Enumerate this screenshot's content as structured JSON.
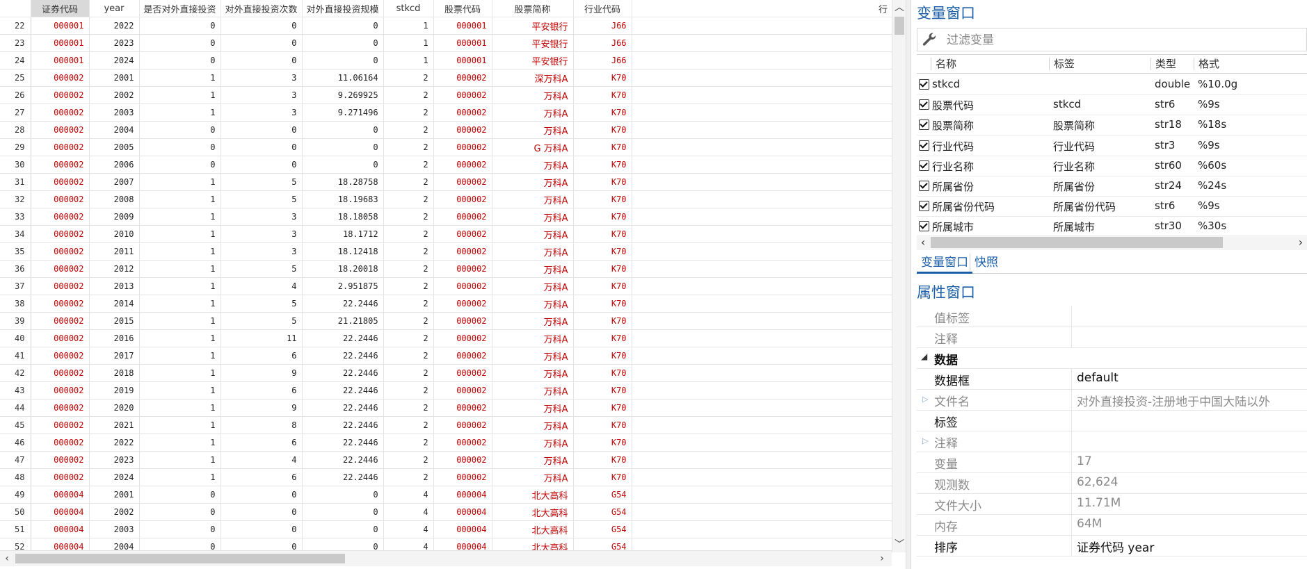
{
  "grid": {
    "columns": [
      "证券代码",
      "year",
      "是否对外直接投资",
      "对外直接投资次数",
      "对外直接投资规模",
      "stkcd",
      "股票代码",
      "股票简称",
      "行业代码"
    ],
    "extra_header": "行",
    "rows": [
      {
        "n": "22",
        "code": "000001",
        "year": "2022",
        "odi": "0",
        "times": "0",
        "scale": "0",
        "stkcd": "1",
        "stock": "000001",
        "name": "平安银行",
        "ind": "J66"
      },
      {
        "n": "23",
        "code": "000001",
        "year": "2023",
        "odi": "0",
        "times": "0",
        "scale": "0",
        "stkcd": "1",
        "stock": "000001",
        "name": "平安银行",
        "ind": "J66"
      },
      {
        "n": "24",
        "code": "000001",
        "year": "2024",
        "odi": "0",
        "times": "0",
        "scale": "0",
        "stkcd": "1",
        "stock": "000001",
        "name": "平安银行",
        "ind": "J66"
      },
      {
        "n": "25",
        "code": "000002",
        "year": "2001",
        "odi": "1",
        "times": "3",
        "scale": "11.06164",
        "stkcd": "2",
        "stock": "000002",
        "name": "深万科A",
        "ind": "K70"
      },
      {
        "n": "26",
        "code": "000002",
        "year": "2002",
        "odi": "1",
        "times": "3",
        "scale": "9.269925",
        "stkcd": "2",
        "stock": "000002",
        "name": "万科A",
        "ind": "K70"
      },
      {
        "n": "27",
        "code": "000002",
        "year": "2003",
        "odi": "1",
        "times": "3",
        "scale": "9.271496",
        "stkcd": "2",
        "stock": "000002",
        "name": "万科A",
        "ind": "K70"
      },
      {
        "n": "28",
        "code": "000002",
        "year": "2004",
        "odi": "0",
        "times": "0",
        "scale": "0",
        "stkcd": "2",
        "stock": "000002",
        "name": "万科A",
        "ind": "K70"
      },
      {
        "n": "29",
        "code": "000002",
        "year": "2005",
        "odi": "0",
        "times": "0",
        "scale": "0",
        "stkcd": "2",
        "stock": "000002",
        "name": "G 万科A",
        "ind": "K70"
      },
      {
        "n": "30",
        "code": "000002",
        "year": "2006",
        "odi": "0",
        "times": "0",
        "scale": "0",
        "stkcd": "2",
        "stock": "000002",
        "name": "万科A",
        "ind": "K70"
      },
      {
        "n": "31",
        "code": "000002",
        "year": "2007",
        "odi": "1",
        "times": "5",
        "scale": "18.28758",
        "stkcd": "2",
        "stock": "000002",
        "name": "万科A",
        "ind": "K70"
      },
      {
        "n": "32",
        "code": "000002",
        "year": "2008",
        "odi": "1",
        "times": "5",
        "scale": "18.19683",
        "stkcd": "2",
        "stock": "000002",
        "name": "万科A",
        "ind": "K70"
      },
      {
        "n": "33",
        "code": "000002",
        "year": "2009",
        "odi": "1",
        "times": "3",
        "scale": "18.18058",
        "stkcd": "2",
        "stock": "000002",
        "name": "万科A",
        "ind": "K70"
      },
      {
        "n": "34",
        "code": "000002",
        "year": "2010",
        "odi": "1",
        "times": "3",
        "scale": "18.1712",
        "stkcd": "2",
        "stock": "000002",
        "name": "万科A",
        "ind": "K70"
      },
      {
        "n": "35",
        "code": "000002",
        "year": "2011",
        "odi": "1",
        "times": "3",
        "scale": "18.12418",
        "stkcd": "2",
        "stock": "000002",
        "name": "万科A",
        "ind": "K70"
      },
      {
        "n": "36",
        "code": "000002",
        "year": "2012",
        "odi": "1",
        "times": "5",
        "scale": "18.20018",
        "stkcd": "2",
        "stock": "000002",
        "name": "万科A",
        "ind": "K70"
      },
      {
        "n": "37",
        "code": "000002",
        "year": "2013",
        "odi": "1",
        "times": "4",
        "scale": "2.951875",
        "stkcd": "2",
        "stock": "000002",
        "name": "万科A",
        "ind": "K70"
      },
      {
        "n": "38",
        "code": "000002",
        "year": "2014",
        "odi": "1",
        "times": "5",
        "scale": "22.2446",
        "stkcd": "2",
        "stock": "000002",
        "name": "万科A",
        "ind": "K70"
      },
      {
        "n": "39",
        "code": "000002",
        "year": "2015",
        "odi": "1",
        "times": "5",
        "scale": "21.21805",
        "stkcd": "2",
        "stock": "000002",
        "name": "万科A",
        "ind": "K70"
      },
      {
        "n": "40",
        "code": "000002",
        "year": "2016",
        "odi": "1",
        "times": "11",
        "scale": "22.2446",
        "stkcd": "2",
        "stock": "000002",
        "name": "万科A",
        "ind": "K70"
      },
      {
        "n": "41",
        "code": "000002",
        "year": "2017",
        "odi": "1",
        "times": "6",
        "scale": "22.2446",
        "stkcd": "2",
        "stock": "000002",
        "name": "万科A",
        "ind": "K70"
      },
      {
        "n": "42",
        "code": "000002",
        "year": "2018",
        "odi": "1",
        "times": "9",
        "scale": "22.2446",
        "stkcd": "2",
        "stock": "000002",
        "name": "万科A",
        "ind": "K70"
      },
      {
        "n": "43",
        "code": "000002",
        "year": "2019",
        "odi": "1",
        "times": "6",
        "scale": "22.2446",
        "stkcd": "2",
        "stock": "000002",
        "name": "万科A",
        "ind": "K70"
      },
      {
        "n": "44",
        "code": "000002",
        "year": "2020",
        "odi": "1",
        "times": "9",
        "scale": "22.2446",
        "stkcd": "2",
        "stock": "000002",
        "name": "万科A",
        "ind": "K70"
      },
      {
        "n": "45",
        "code": "000002",
        "year": "2021",
        "odi": "1",
        "times": "8",
        "scale": "22.2446",
        "stkcd": "2",
        "stock": "000002",
        "name": "万科A",
        "ind": "K70"
      },
      {
        "n": "46",
        "code": "000002",
        "year": "2022",
        "odi": "1",
        "times": "6",
        "scale": "22.2446",
        "stkcd": "2",
        "stock": "000002",
        "name": "万科A",
        "ind": "K70"
      },
      {
        "n": "47",
        "code": "000002",
        "year": "2023",
        "odi": "1",
        "times": "4",
        "scale": "22.2446",
        "stkcd": "2",
        "stock": "000002",
        "name": "万科A",
        "ind": "K70"
      },
      {
        "n": "48",
        "code": "000002",
        "year": "2024",
        "odi": "1",
        "times": "6",
        "scale": "22.2446",
        "stkcd": "2",
        "stock": "000002",
        "name": "万科A",
        "ind": "K70"
      },
      {
        "n": "49",
        "code": "000004",
        "year": "2001",
        "odi": "0",
        "times": "0",
        "scale": "0",
        "stkcd": "4",
        "stock": "000004",
        "name": "北大高科",
        "ind": "G54"
      },
      {
        "n": "50",
        "code": "000004",
        "year": "2002",
        "odi": "0",
        "times": "0",
        "scale": "0",
        "stkcd": "4",
        "stock": "000004",
        "name": "北大高科",
        "ind": "G54"
      },
      {
        "n": "51",
        "code": "000004",
        "year": "2003",
        "odi": "0",
        "times": "0",
        "scale": "0",
        "stkcd": "4",
        "stock": "000004",
        "name": "北大高科",
        "ind": "G54"
      },
      {
        "n": "52",
        "code": "000004",
        "year": "2004",
        "odi": "0",
        "times": "0",
        "scale": "0",
        "stkcd": "4",
        "stock": "000004",
        "name": "北大高科",
        "ind": "G54"
      }
    ]
  },
  "variables_pane": {
    "title": "变量窗口",
    "filter_placeholder": "过滤变量",
    "headers": {
      "name": "名称",
      "label": "标签",
      "type": "类型",
      "format": "格式"
    },
    "items": [
      {
        "name": "stkcd",
        "label": "",
        "type": "double",
        "format": "%10.0g"
      },
      {
        "name": "股票代码",
        "label": "stkcd",
        "type": "str6",
        "format": "%9s"
      },
      {
        "name": "股票简称",
        "label": "股票简称",
        "type": "str18",
        "format": "%18s"
      },
      {
        "name": "行业代码",
        "label": "行业代码",
        "type": "str3",
        "format": "%9s"
      },
      {
        "name": "行业名称",
        "label": "行业名称",
        "type": "str60",
        "format": "%60s"
      },
      {
        "name": "所属省份",
        "label": "所属省份",
        "type": "str24",
        "format": "%24s"
      },
      {
        "name": "所属省份代码",
        "label": "所属省份代码",
        "type": "str6",
        "format": "%9s"
      },
      {
        "name": "所属城市",
        "label": "所属城市",
        "type": "str30",
        "format": "%30s"
      }
    ]
  },
  "tabs": {
    "variables": "变量窗口",
    "snapshots": "快照"
  },
  "properties_pane": {
    "title": "属性窗口",
    "value_label_key": "值标签",
    "notes_key": "注释",
    "group_data": "数据",
    "frame_key": "数据框",
    "frame_val": "default",
    "filename_key": "文件名",
    "filename_val": "对外直接投资-注册地于中国大陆以外",
    "label_key": "标签",
    "notes2_key": "注释",
    "vars_key": "变量",
    "vars_val": "17",
    "obs_key": "观测数",
    "obs_val": "62,624",
    "size_key": "文件大小",
    "size_val": "11.71M",
    "mem_key": "内存",
    "mem_val": "64M",
    "sort_key": "排序",
    "sort_val": "证券代码 year"
  },
  "colors": {
    "accent": "#1b5fa8",
    "string_value": "#c00000"
  }
}
